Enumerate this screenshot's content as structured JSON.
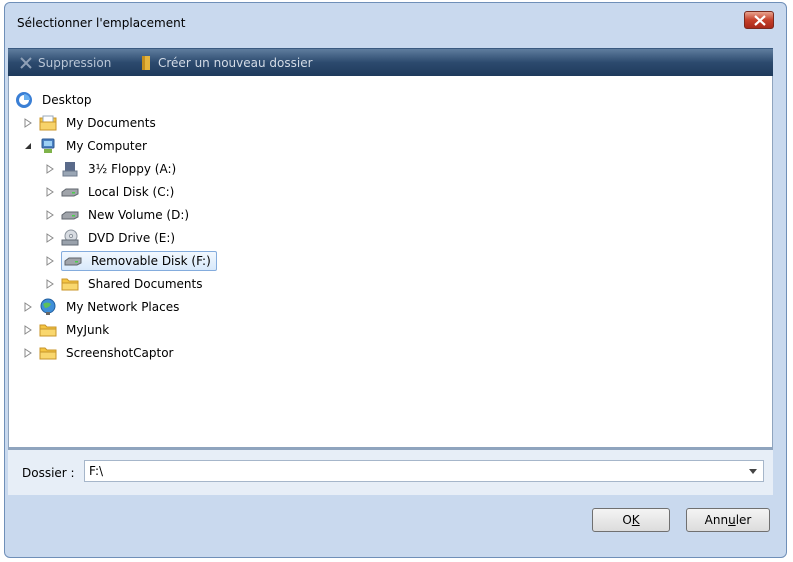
{
  "window": {
    "title": "Sélectionner l'emplacement"
  },
  "toolbar": {
    "delete_label": "Suppression",
    "new_folder_label": "Créer un nouveau dossier"
  },
  "tree": {
    "items": [
      {
        "label": "Desktop",
        "icon": "desktop-icon",
        "level": 0,
        "arrow": "none"
      },
      {
        "label": "My Documents",
        "icon": "my-documents-icon",
        "level": 1,
        "arrow": "collapsed"
      },
      {
        "label": "My Computer",
        "icon": "my-computer-icon",
        "level": 1,
        "arrow": "expanded"
      },
      {
        "label": "3½ Floppy (A:)",
        "icon": "floppy-drive-icon",
        "level": 2,
        "arrow": "collapsed"
      },
      {
        "label": "Local Disk (C:)",
        "icon": "hard-disk-icon",
        "level": 2,
        "arrow": "collapsed"
      },
      {
        "label": "New Volume (D:)",
        "icon": "hard-disk-icon",
        "level": 2,
        "arrow": "collapsed"
      },
      {
        "label": "DVD Drive (E:)",
        "icon": "dvd-drive-icon",
        "level": 2,
        "arrow": "collapsed"
      },
      {
        "label": "Removable Disk (F:)",
        "icon": "removable-disk-icon",
        "level": 2,
        "arrow": "collapsed",
        "selected": true
      },
      {
        "label": "Shared Documents",
        "icon": "folder-icon",
        "level": 2,
        "arrow": "collapsed"
      },
      {
        "label": "My Network Places",
        "icon": "network-places-icon",
        "level": 1,
        "arrow": "collapsed"
      },
      {
        "label": "MyJunk",
        "icon": "folder-icon",
        "level": 1,
        "arrow": "collapsed"
      },
      {
        "label": "ScreenshotCaptor",
        "icon": "folder-icon",
        "level": 1,
        "arrow": "collapsed"
      }
    ]
  },
  "folder": {
    "label": "Dossier :",
    "value": "F:\\"
  },
  "buttons": {
    "ok_label_pre": "O",
    "ok_label_u": "K",
    "cancel_label_pre": "Ann",
    "cancel_label_u": "u",
    "cancel_label_post": "ler"
  },
  "colors": {
    "toolbar": "#2c4a6e",
    "close": "#c6402a",
    "selection": "#d8e9fb",
    "folder": "#f5c542"
  }
}
